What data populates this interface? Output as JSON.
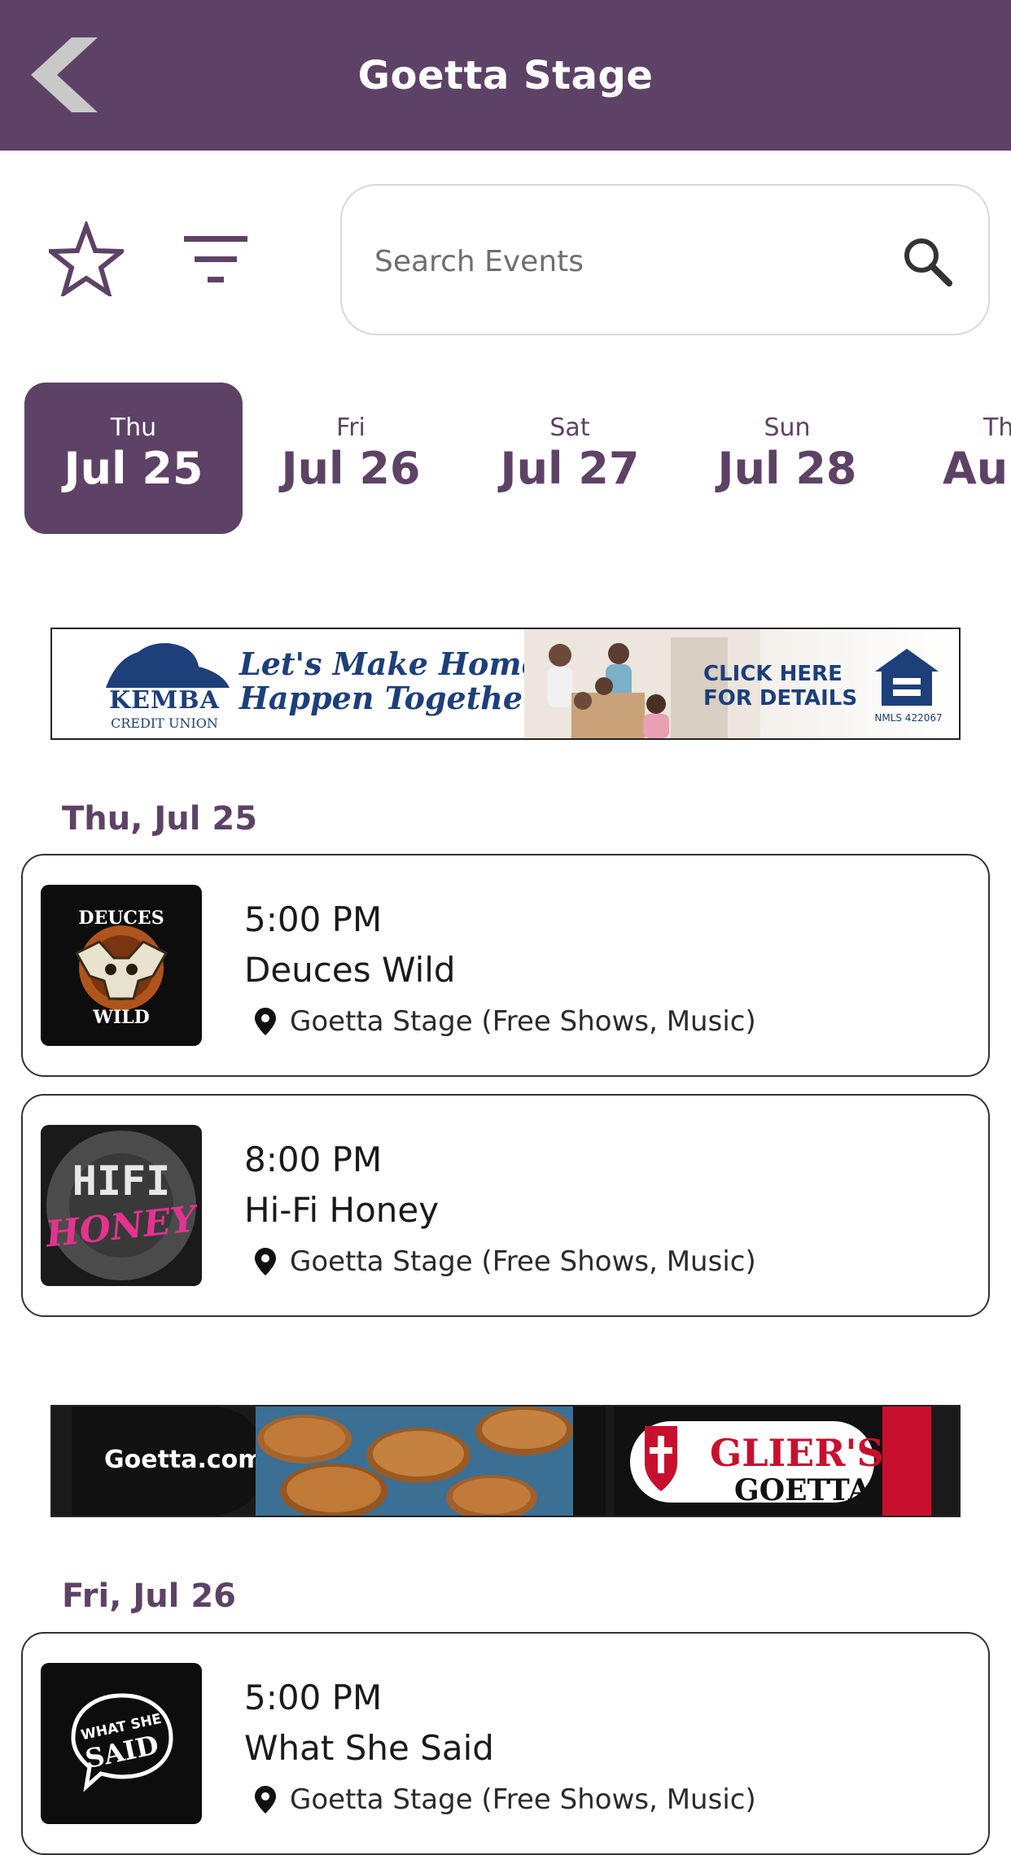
{
  "header": {
    "title": "Goetta Stage"
  },
  "toolbar": {
    "search_placeholder": "Search Events"
  },
  "dates": [
    {
      "dow": "Thu",
      "day": "Jul 25",
      "active": true
    },
    {
      "dow": "Fri",
      "day": "Jul 26",
      "active": false
    },
    {
      "dow": "Sat",
      "day": "Jul 27",
      "active": false
    },
    {
      "dow": "Sun",
      "day": "Jul 28",
      "active": false
    },
    {
      "dow": "Th",
      "day": "Au",
      "active": false
    }
  ],
  "ads": {
    "kemba": {
      "logo_text": "KEMBA",
      "logo_subtext": "CREDIT UNION",
      "tagline_line1": "Let's Make Home",
      "tagline_line2": "Happen Together",
      "cta_line1": "CLICK HERE",
      "cta_line2": "FOR DETAILS",
      "license": "NMLS 422067"
    },
    "gliers": {
      "url": "Goetta.com",
      "brand_line1": "GLIER'S",
      "brand_line2": "GOETTA"
    }
  },
  "sections": [
    {
      "label": "Thu, Jul 25",
      "events": [
        {
          "time": "5:00 PM",
          "name": "Deuces Wild",
          "location": "Goetta Stage (Free Shows, Music)",
          "thumb_top": "DEUCES",
          "thumb_bottom": "WILD"
        },
        {
          "time": "8:00 PM",
          "name": "Hi-Fi Honey",
          "location": "Goetta Stage (Free Shows, Music)",
          "thumb_top": "HIFI",
          "thumb_bottom": "HONEY"
        }
      ]
    },
    {
      "label": "Fri, Jul 26",
      "events": [
        {
          "time": "5:00 PM",
          "name": "What She Said",
          "location": "Goetta Stage (Free Shows, Music)",
          "thumb_top": "WHAT SHE",
          "thumb_bottom": "SAID"
        }
      ]
    }
  ],
  "colors": {
    "brand": "#5d4266",
    "white": "#ffffff",
    "kemba_blue": "#1d3f7a",
    "gliers_red": "#c8102e"
  },
  "icons": {
    "back": "chevron-left-icon",
    "favorite": "star-outline-icon",
    "filter": "filter-lines-icon",
    "search": "search-icon",
    "location": "map-pin-icon"
  }
}
